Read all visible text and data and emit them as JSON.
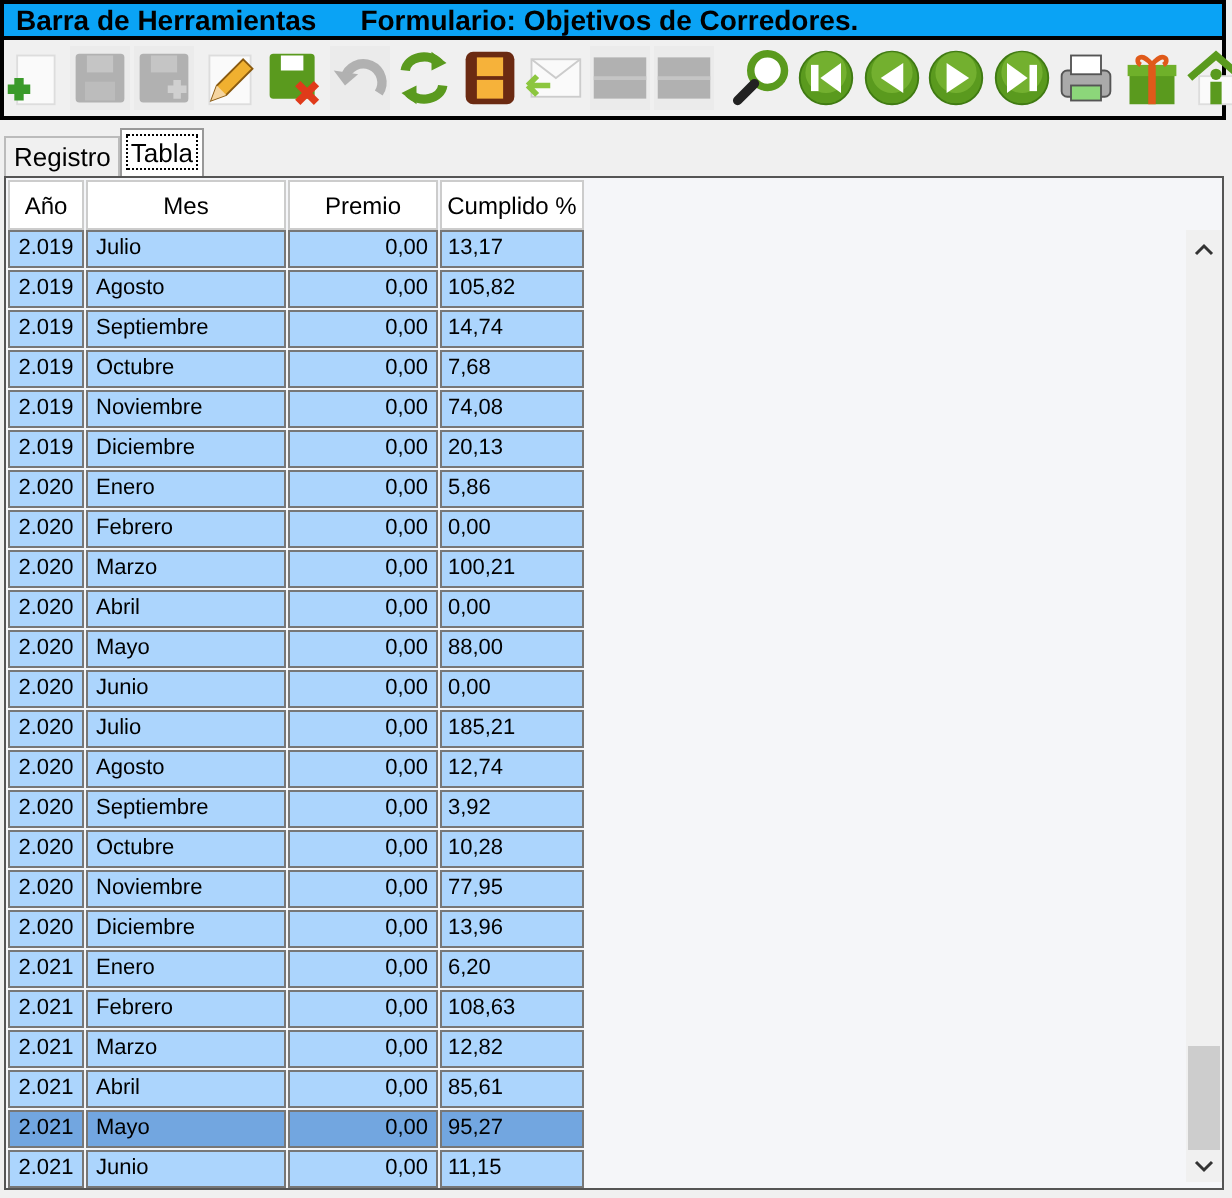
{
  "window": {
    "title": "Barra de Herramientas",
    "form_title": "Formulario: Objetivos de Corredores."
  },
  "toolbar": [
    {
      "kind": "new",
      "disabled": false
    },
    {
      "kind": "save",
      "disabled": true
    },
    {
      "kind": "save-as",
      "disabled": true
    },
    {
      "kind": "edit",
      "disabled": false
    },
    {
      "kind": "cancel",
      "disabled": false
    },
    {
      "kind": "undo",
      "disabled": true
    },
    {
      "kind": "refresh",
      "disabled": false
    },
    {
      "kind": "film",
      "disabled": false
    },
    {
      "kind": "mail",
      "disabled": false
    },
    {
      "kind": "bar",
      "disabled": true
    },
    {
      "kind": "bar",
      "disabled": true
    },
    {
      "kind": "search",
      "disabled": false
    },
    {
      "kind": "first",
      "disabled": false
    },
    {
      "kind": "prev",
      "disabled": false
    },
    {
      "kind": "next",
      "disabled": false
    },
    {
      "kind": "last",
      "disabled": false
    },
    {
      "kind": "printer",
      "disabled": false
    },
    {
      "kind": "gift",
      "disabled": false
    },
    {
      "kind": "home",
      "disabled": false
    }
  ],
  "tabs": [
    {
      "label": "Registro",
      "selected": false
    },
    {
      "label": "Tabla",
      "selected": true
    }
  ],
  "table": {
    "columns": [
      "Año",
      "Mes",
      "Premio",
      "Cumplido %"
    ],
    "rows": [
      {
        "year": "2.019",
        "month": "Julio",
        "premio": "0,00",
        "cumplido": "13,17",
        "selected": false
      },
      {
        "year": "2.019",
        "month": "Agosto",
        "premio": "0,00",
        "cumplido": "105,82",
        "selected": false
      },
      {
        "year": "2.019",
        "month": "Septiembre",
        "premio": "0,00",
        "cumplido": "14,74",
        "selected": false
      },
      {
        "year": "2.019",
        "month": "Octubre",
        "premio": "0,00",
        "cumplido": "7,68",
        "selected": false
      },
      {
        "year": "2.019",
        "month": "Noviembre",
        "premio": "0,00",
        "cumplido": "74,08",
        "selected": false
      },
      {
        "year": "2.019",
        "month": "Diciembre",
        "premio": "0,00",
        "cumplido": "20,13",
        "selected": false
      },
      {
        "year": "2.020",
        "month": "Enero",
        "premio": "0,00",
        "cumplido": "5,86",
        "selected": false
      },
      {
        "year": "2.020",
        "month": "Febrero",
        "premio": "0,00",
        "cumplido": "0,00",
        "selected": false
      },
      {
        "year": "2.020",
        "month": "Marzo",
        "premio": "0,00",
        "cumplido": "100,21",
        "selected": false
      },
      {
        "year": "2.020",
        "month": "Abril",
        "premio": "0,00",
        "cumplido": "0,00",
        "selected": false
      },
      {
        "year": "2.020",
        "month": "Mayo",
        "premio": "0,00",
        "cumplido": "88,00",
        "selected": false
      },
      {
        "year": "2.020",
        "month": "Junio",
        "premio": "0,00",
        "cumplido": "0,00",
        "selected": false
      },
      {
        "year": "2.020",
        "month": "Julio",
        "premio": "0,00",
        "cumplido": "185,21",
        "selected": false
      },
      {
        "year": "2.020",
        "month": "Agosto",
        "premio": "0,00",
        "cumplido": "12,74",
        "selected": false
      },
      {
        "year": "2.020",
        "month": "Septiembre",
        "premio": "0,00",
        "cumplido": "3,92",
        "selected": false
      },
      {
        "year": "2.020",
        "month": "Octubre",
        "premio": "0,00",
        "cumplido": "10,28",
        "selected": false
      },
      {
        "year": "2.020",
        "month": "Noviembre",
        "premio": "0,00",
        "cumplido": "77,95",
        "selected": false
      },
      {
        "year": "2.020",
        "month": "Diciembre",
        "premio": "0,00",
        "cumplido": "13,96",
        "selected": false
      },
      {
        "year": "2.021",
        "month": "Enero",
        "premio": "0,00",
        "cumplido": "6,20",
        "selected": false
      },
      {
        "year": "2.021",
        "month": "Febrero",
        "premio": "0,00",
        "cumplido": "108,63",
        "selected": false
      },
      {
        "year": "2.021",
        "month": "Marzo",
        "premio": "0,00",
        "cumplido": "12,82",
        "selected": false
      },
      {
        "year": "2.021",
        "month": "Abril",
        "premio": "0,00",
        "cumplido": "85,61",
        "selected": false
      },
      {
        "year": "2.021",
        "month": "Mayo",
        "premio": "0,00",
        "cumplido": "95,27",
        "selected": true
      },
      {
        "year": "2.021",
        "month": "Junio",
        "premio": "0,00",
        "cumplido": "11,15",
        "selected": false
      }
    ]
  }
}
